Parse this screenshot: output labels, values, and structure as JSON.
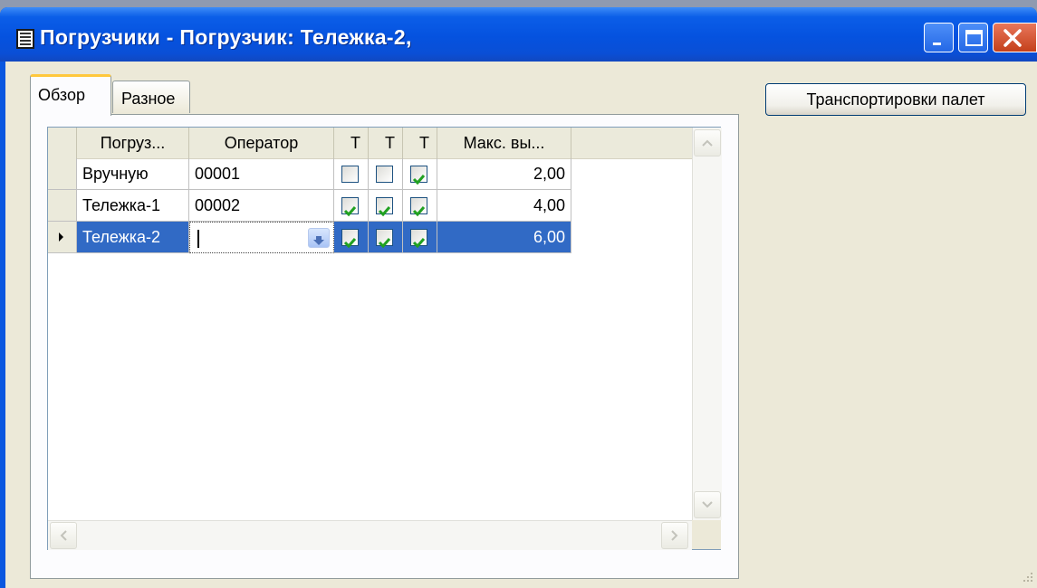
{
  "window": {
    "title": "Погрузчики - Погрузчик: Тележка-2,",
    "controls": [
      "minimize",
      "maximize",
      "close"
    ]
  },
  "tabs": [
    {
      "label": "Обзор",
      "active": true
    },
    {
      "label": "Разное",
      "active": false
    }
  ],
  "grid": {
    "columns": [
      "Погруз...",
      "Оператор",
      "Т",
      "Т",
      "Т",
      "Макс. вы..."
    ],
    "rows": [
      {
        "name": "Вручную",
        "operator": "00001",
        "c1": false,
        "c2": false,
        "c3": true,
        "max": "2,00",
        "selected": false
      },
      {
        "name": "Тележка-1",
        "operator": "00002",
        "c1": true,
        "c2": true,
        "c3": true,
        "max": "4,00",
        "selected": false
      },
      {
        "name": "Тележка-2",
        "operator": "",
        "c1": true,
        "c2": true,
        "c3": true,
        "max": "6,00",
        "selected": true
      }
    ]
  },
  "actions": {
    "pallet_transport_label": "Транспортировки палет"
  },
  "colors": {
    "titlebar": "#0552df",
    "selection": "#316ac5",
    "face": "#ece9d8",
    "check": "#21a121"
  },
  "icons": [
    "app-icon",
    "minimize-icon",
    "maximize-icon",
    "close-icon",
    "row-pointer-icon",
    "dropdown-lookup-icon",
    "checkmark-icon",
    "scroll-up-icon",
    "scroll-down-icon",
    "scroll-left-icon",
    "scroll-right-icon",
    "resize-grip-icon"
  ]
}
